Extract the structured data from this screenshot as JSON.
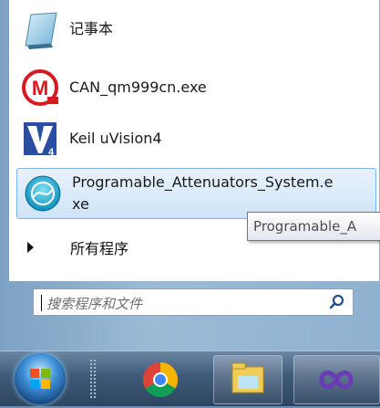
{
  "programs": [
    {
      "label": "记事本",
      "icon": "notepad-icon"
    },
    {
      "label": "CAN_qm999cn.exe",
      "icon": "can-app-icon"
    },
    {
      "label": "Keil uVision4",
      "icon": "keil-uvision-icon"
    },
    {
      "label": "Programable_Attenuators_System.exe",
      "icon": "attenuator-app-icon"
    }
  ],
  "all_programs_label": "所有程序",
  "tooltip_text": "Programable_A",
  "search": {
    "placeholder": "搜索程序和文件"
  },
  "taskbar": [
    "start-orb-icon",
    "chrome-icon",
    "file-explorer-icon",
    "visual-studio-icon"
  ],
  "colors": {
    "highlight": "#cfe4f9",
    "highlight_border": "#7eb4ea"
  }
}
